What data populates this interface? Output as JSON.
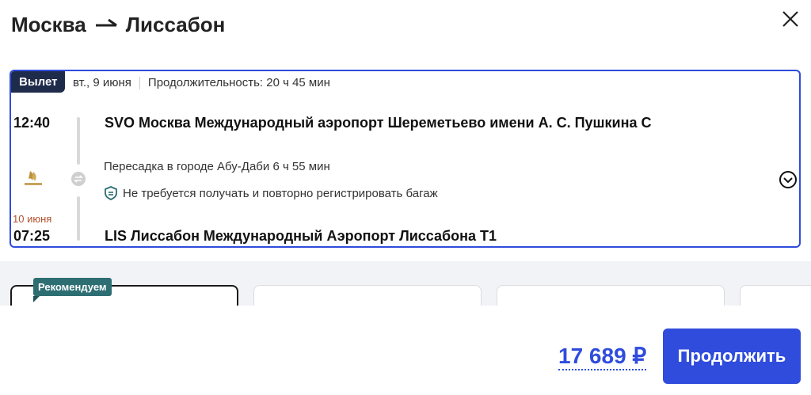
{
  "header": {
    "origin": "Москва",
    "destination": "Лиссабон",
    "close_icon": "close-icon"
  },
  "segment": {
    "badge": "Вылет",
    "date": "вт., 9 июня",
    "duration": "Продолжительность: 20 ч 45 мин",
    "departure_time": "12:40",
    "departure_airport": "SVO Москва Международный аэропорт Шереметьево имени А. С. Пушкина C",
    "transfer_text": "Пересадка в городе Абу-Даби  6 ч 55 мин",
    "baggage_text": "Не требуется получать и повторно регистрировать багаж",
    "arrival_date": "10 июня",
    "arrival_time": "07:25",
    "arrival_airport": "LIS Лиссабон Международный Аэропорт Лиссабона T1",
    "airline_logo": "etihad-logo"
  },
  "fares": {
    "recommended_label": "Рекомендуем"
  },
  "footer": {
    "price": "17 689 ₽",
    "continue_label": "Продолжить"
  },
  "colors": {
    "accent": "#2f4cdd",
    "badge_dark": "#1f2b4a",
    "recommend": "#2d6e73",
    "next_day": "#b0502a"
  }
}
